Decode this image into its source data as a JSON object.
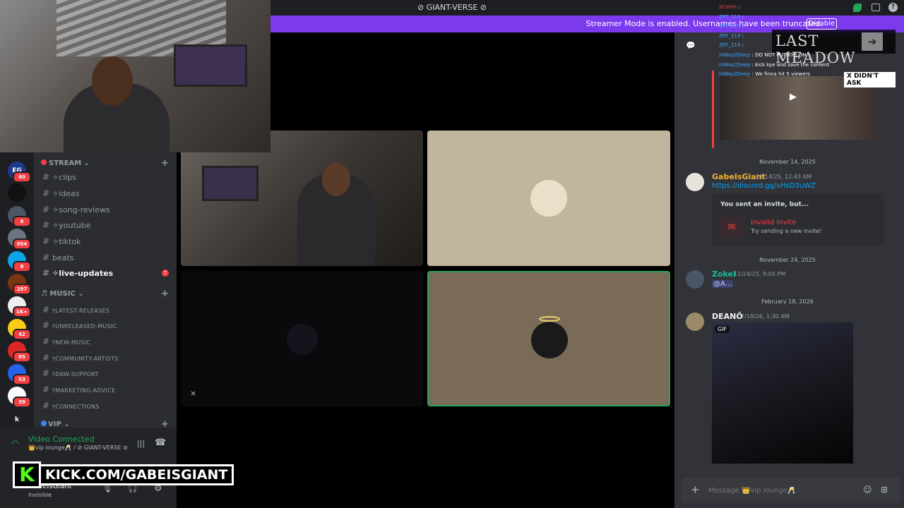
{
  "window": {
    "title": "⊘ GIANT-VERSE ⊘"
  },
  "streamer_banner": {
    "message": "Streamer Mode is enabled. Usernames have been truncated.",
    "disable_label": "Disable"
  },
  "servers": [
    {
      "label": "EG",
      "badge": "60"
    },
    {
      "label": "",
      "badge": ""
    },
    {
      "label": "",
      "badge": "8"
    },
    {
      "label": "",
      "badge": "954"
    },
    {
      "label": "",
      "badge": "8"
    },
    {
      "label": "",
      "badge": "297"
    },
    {
      "label": "",
      "badge": "1K+"
    },
    {
      "label": "",
      "badge": "42"
    },
    {
      "label": "",
      "badge": "85"
    },
    {
      "label": "",
      "badge": "53"
    },
    {
      "label": "",
      "badge": "39"
    },
    {
      "label": "k",
      "badge": ""
    }
  ],
  "categories": {
    "stream": "STREAM",
    "music": "MUSIC",
    "vip": "VIP"
  },
  "stream_channels": [
    "✧clips",
    "✧ideas",
    "✧song-reviews",
    "✧youtube",
    "✧tiktok",
    "beats",
    "✧live-updates"
  ],
  "live_updates_unread": "7",
  "music_channels": [
    "†LATEST-RELEASES",
    "†UNRELEASED-MUSIC",
    "†NEW-MUSIC",
    "†COMMUNITY-ARTISTS",
    "†DAW-SUPPORT",
    "†MARKETING-ADVICE",
    "†CONNECTIONS"
  ],
  "voice": {
    "status": "Video Connected",
    "channel": "👑vip lounge🥂 / ⊘ GIANT-VERSE ⊘"
  },
  "user": {
    "name": "GabeIsGiant",
    "status": "Invisible"
  },
  "kick": {
    "text": "KICK.COM/GABEISGIANT",
    "logo": "K"
  },
  "overlay_chat": {
    "banner": "LAST MEADOW",
    "tag": "X DIDN'T ASK",
    "lines": [
      {
        "name": "SCottie",
        "text": ""
      },
      {
        "name": "ZRT_219",
        "text": ""
      },
      {
        "name": "ZRT_219",
        "text": ""
      },
      {
        "name": "ZRT_219",
        "text": ""
      },
      {
        "name": "ZRT_219",
        "text": ""
      },
      {
        "name": "InWay2Deep",
        "text": "DO NOT PUT KYE ON"
      },
      {
        "name": "InWay2Deep",
        "text": "kick kye and save the content"
      },
      {
        "name": "InWay2Deep",
        "text": "We finna hit 5 viewers"
      }
    ]
  },
  "chat": {
    "dates": [
      "November 14, 2025",
      "November 24, 2025",
      "February 18, 2026"
    ],
    "messages": [
      {
        "author": "GabeIsGiant",
        "time": "11/14/25, 12:43 AM",
        "link": "https://discord.gg/vHsD3uWZ",
        "invite_title": "You sent an invite, but...",
        "invite_status": "Invalid Invite",
        "invite_hint": "Try sending a new invite!"
      },
      {
        "author": "Zokel",
        "time": "11/24/25, 9:05 PM",
        "mention": "@A..."
      },
      {
        "author": "DEANŌ",
        "time": "2/18/26, 1:30 AM",
        "gif_label": "GIF"
      }
    ],
    "composer_placeholder": "Message 👑vip lounge🥂"
  },
  "colors": {
    "accent": "#7c3aed",
    "link": "#00a8fc",
    "online": "#23a55a",
    "danger": "#f23f43",
    "kick": "#53fc18"
  }
}
